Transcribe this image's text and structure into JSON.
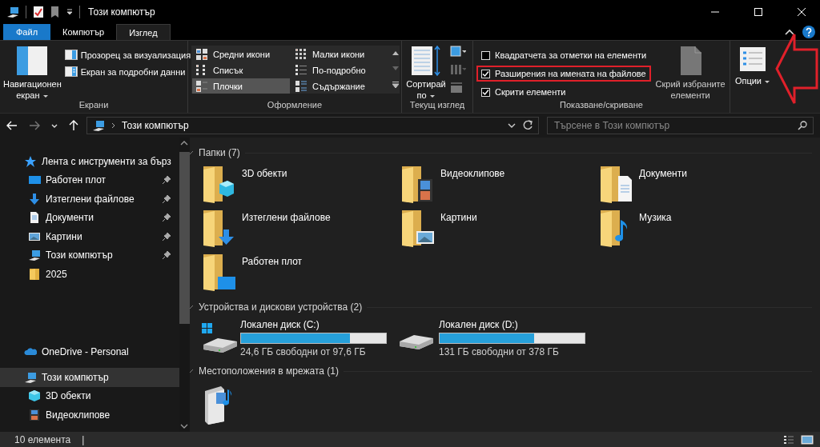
{
  "window": {
    "title": "Този компютър"
  },
  "ribbon": {
    "tabs": [
      {
        "label": "Файл",
        "kind": "file",
        "selected": false
      },
      {
        "label": "Компютър",
        "kind": "tab",
        "selected": false
      },
      {
        "label": "Изглед",
        "kind": "tab",
        "selected": true
      }
    ],
    "groups": [
      {
        "title": "Екрани",
        "kind": "panes",
        "large_button": {
          "label": "Навигационен екран",
          "dropdown": true
        },
        "buttons": [
          {
            "label": "Прозорец за визуализация",
            "kind": "preview"
          },
          {
            "label": "Екран за подробни данни",
            "kind": "details"
          }
        ]
      },
      {
        "title": "Оформление",
        "kind": "layout",
        "options": [
          {
            "label": "Средни икони",
            "kind": "medium_icons",
            "selected": false
          },
          {
            "label": "Малки икони",
            "kind": "small_icons",
            "selected": false
          },
          {
            "label": "Списък",
            "kind": "list",
            "selected": false
          },
          {
            "label": "По-подробно",
            "kind": "details",
            "selected": false
          },
          {
            "label": "Плочки",
            "kind": "tiles",
            "selected": true
          },
          {
            "label": "Съдържание",
            "kind": "content",
            "selected": false
          }
        ]
      },
      {
        "title": "Текущ изглед",
        "kind": "current_view",
        "large_button": {
          "label": "Сортирай по",
          "dropdown": true
        }
      },
      {
        "title": "Показване/скриване",
        "kind": "show_hide",
        "checkboxes": [
          {
            "label": "Квадратчета за отметки на елементи",
            "checked": false,
            "highlighted": false
          },
          {
            "label": "Разширения на имената на файлове",
            "checked": true,
            "highlighted": true
          },
          {
            "label": "Скрити елементи",
            "checked": true,
            "highlighted": false
          }
        ],
        "large_button": {
          "label": "Скрий избраните елементи",
          "dropdown": false
        }
      },
      {
        "kind": "options",
        "large_button": {
          "label": "Опции",
          "dropdown": true
        }
      }
    ]
  },
  "address": {
    "location": "Този компютър"
  },
  "search": {
    "placeholder": "Търсене в Този компютър"
  },
  "nav": {
    "groups": [
      {
        "label": "Лента с инструменти за бърз",
        "kind": "star",
        "selected": false,
        "children": [
          {
            "label": "Работен плот",
            "kind": "desktop",
            "pinned": true,
            "selected": false
          },
          {
            "label": "Изтеглени файлове",
            "kind": "download",
            "pinned": true,
            "selected": false
          },
          {
            "label": "Документи",
            "kind": "document",
            "pinned": true,
            "selected": false
          },
          {
            "label": "Картини",
            "kind": "picture",
            "pinned": true,
            "selected": false
          },
          {
            "label": "Този компютър",
            "kind": "computer",
            "pinned": true,
            "selected": false
          },
          {
            "label": "2025",
            "kind": "folder",
            "pinned": false,
            "selected": false
          }
        ]
      },
      {
        "label": "OneDrive - Personal",
        "kind": "cloud",
        "selected": false
      },
      {
        "label": "Този компютър",
        "kind": "computer",
        "selected": true,
        "children": [
          {
            "label": "3D обекти",
            "kind": "cube",
            "pinned": false,
            "selected": false
          },
          {
            "label": "Видеоклипове",
            "kind": "film",
            "pinned": false,
            "selected": false
          }
        ]
      }
    ]
  },
  "sections": [
    {
      "title": "Папки (7)",
      "kind": "folders",
      "items": [
        {
          "label": "3D обекти",
          "kind": "cube"
        },
        {
          "label": "Видеоклипове",
          "kind": "videos"
        },
        {
          "label": "Документи",
          "kind": "documents"
        },
        {
          "label": "Изтеглени файлове",
          "kind": "downloads"
        },
        {
          "label": "Картини",
          "kind": "pictures"
        },
        {
          "label": "Музика",
          "kind": "music"
        },
        {
          "label": "Работен плот",
          "kind": "desktop"
        }
      ]
    },
    {
      "title": "Устройства и дискови устройства (2)",
      "kind": "drives",
      "items": [
        {
          "label": "Локален диск (C:)",
          "kind": "system",
          "level": 0.75,
          "free": "24,6 ГБ свободни от 97,6 ГБ"
        },
        {
          "label": "Локален диск (D:)",
          "kind": "data",
          "level": 0.65,
          "free": "131 ГБ свободни от 378 ГБ"
        }
      ]
    },
    {
      "title": "Местоположения в мрежата (1)",
      "kind": "network",
      "items": [
        {
          "kind": "media_server"
        }
      ]
    }
  ],
  "status_bar": {
    "count": "10 елемента",
    "separator": "|"
  }
}
